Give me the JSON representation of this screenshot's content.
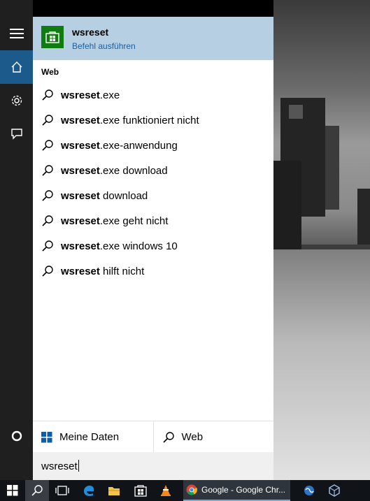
{
  "best_match": {
    "name": "wsreset",
    "subtitle": "Befehl ausführen",
    "icon": "store-icon",
    "tile_color": "#107c10"
  },
  "web_section": {
    "heading": "Web",
    "results": [
      {
        "bold": "wsreset",
        "rest": ".exe"
      },
      {
        "bold": "wsreset",
        "rest": ".exe funktioniert nicht"
      },
      {
        "bold": "wsreset",
        "rest": ".exe-anwendung"
      },
      {
        "bold": "wsreset",
        "rest": ".exe download"
      },
      {
        "bold": "wsreset",
        "rest": " download"
      },
      {
        "bold": "wsreset",
        "rest": ".exe geht nicht"
      },
      {
        "bold": "wsreset",
        "rest": ".exe windows 10"
      },
      {
        "bold": "wsreset",
        "rest": " hilft nicht"
      }
    ]
  },
  "filters": {
    "my_stuff": "Meine Daten",
    "web": "Web"
  },
  "search": {
    "query": "wsreset"
  },
  "taskbar": {
    "chrome_title": "Google - Google Chr..."
  },
  "colors": {
    "accent": "#1c5a8c",
    "best_match_bg": "#b7cfe2",
    "subtitle_link": "#1a5fa0"
  }
}
